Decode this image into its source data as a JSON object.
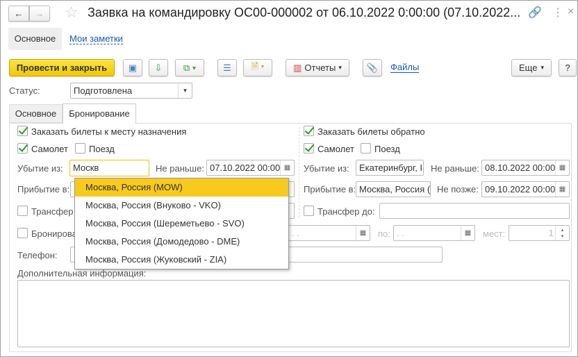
{
  "window": {
    "title": "Заявка на командировку ОС00-000002 от 06.10.2022 0:00:00 (07.10.2022..."
  },
  "nav": {
    "main": "Основное",
    "notes": "Мои заметки"
  },
  "toolbar": {
    "post_close": "Провести и закрыть",
    "reports": "Отчеты",
    "files": "Файлы",
    "more": "Еще",
    "help": "?"
  },
  "status": {
    "label": "Статус:",
    "value": "Подготовлена"
  },
  "tabs": [
    {
      "label": "Основное"
    },
    {
      "label": "Бронирование",
      "active": true
    }
  ],
  "left": {
    "order": "Заказать билеты к месту назначения",
    "plane": "Самолет",
    "train": "Поезд",
    "depart_label": "Убытие из:",
    "depart_value": "Москв",
    "not_before_label": "Не раньше:",
    "not_before": "07.10.2022 00:00",
    "arrive_label": "Прибытие в:",
    "transfer_label": "Трансфер",
    "booking_label": "Бронирова",
    "phone_label": "Телефон:"
  },
  "right": {
    "order": "Заказать билеты обратно",
    "plane": "Самолет",
    "train": "Поезд",
    "depart_label": "Убытие из:",
    "depart_value": "Екатеринбург, I",
    "not_before_label": "Не раньше:",
    "not_before": "08.10.2022 00:00",
    "arrive_label": "Прибытие в:",
    "arrive_value": "Москва, Россия (",
    "not_after_label": "Не позже:",
    "not_after": "09.10.2022 00:00",
    "transfer_label": "Трансфер до:"
  },
  "hotel": {
    "from": " .  .",
    "to_label": "по:",
    "to": " .  .",
    "places_label": "мест:",
    "places": "1"
  },
  "extra_label": "Дополнительная информация:",
  "dropdown": [
    "Москва, Россия (MOW)",
    "Москва, Россия (Внуково - VKO)",
    "Москва, Россия (Шереметьево - SVO)",
    "Москва, Россия (Домодедово - DME)",
    "Москва, Россия (Жуковский - ZIA)"
  ],
  "colors": {
    "accent": "#f8c91f",
    "link": "#1a56b8",
    "check": "#2a9a2a"
  }
}
